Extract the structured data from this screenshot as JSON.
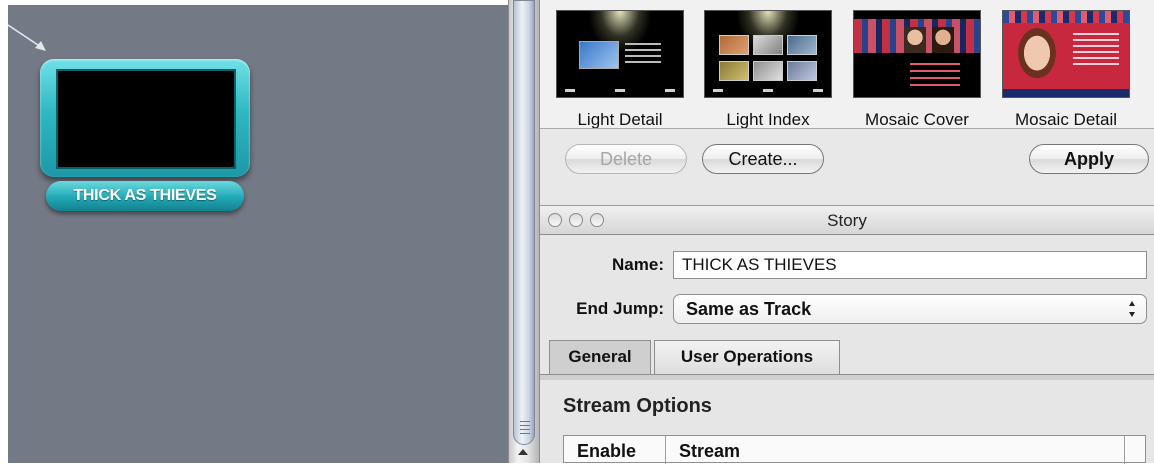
{
  "canvas": {
    "menu_button_label": "THICK AS THIEVES"
  },
  "templates": {
    "items": [
      {
        "caption": "Light Detail"
      },
      {
        "caption": "Light Index"
      },
      {
        "caption": "Mosaic Cover"
      },
      {
        "caption": "Mosaic Detail"
      }
    ]
  },
  "actions": {
    "delete_label": "Delete",
    "create_label": "Create...",
    "apply_label": "Apply"
  },
  "story": {
    "window_title": "Story",
    "name_label": "Name:",
    "name_value": "THICK AS THIEVES",
    "end_jump_label": "End Jump:",
    "end_jump_value": "Same as Track",
    "tabs": [
      {
        "label": "General",
        "selected": true
      },
      {
        "label": "User Operations",
        "selected": false
      }
    ],
    "stream_options_title": "Stream Options",
    "table_headers": [
      "Enable",
      "Stream"
    ]
  },
  "colors": {
    "canvas_bg": "#747986",
    "menu_button_teal": "#2fb8c2",
    "panel_bg": "#e8e8e8"
  }
}
